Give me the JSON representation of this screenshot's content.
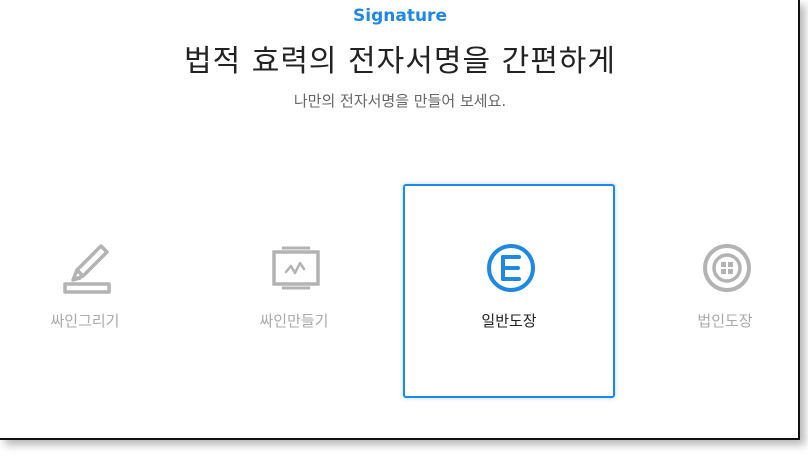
{
  "header": {
    "eyebrow": "Signature",
    "title": "법적 효력의 전자서명을 간편하게",
    "subtitle": "나만의 전자서명을 만들어 보세요."
  },
  "options": [
    {
      "label": "싸인그리기",
      "icon": "pen-drawing-icon",
      "selected": false
    },
    {
      "label": "싸인만들기",
      "icon": "signature-monitor-icon",
      "selected": false
    },
    {
      "label": "일반도장",
      "icon": "round-stamp-icon",
      "selected": true
    },
    {
      "label": "법인도장",
      "icon": "corporate-seal-icon",
      "selected": false
    }
  ],
  "colors": {
    "accent": "#1e88e5",
    "inactive": "#aaaaaa",
    "text": "#222222"
  }
}
